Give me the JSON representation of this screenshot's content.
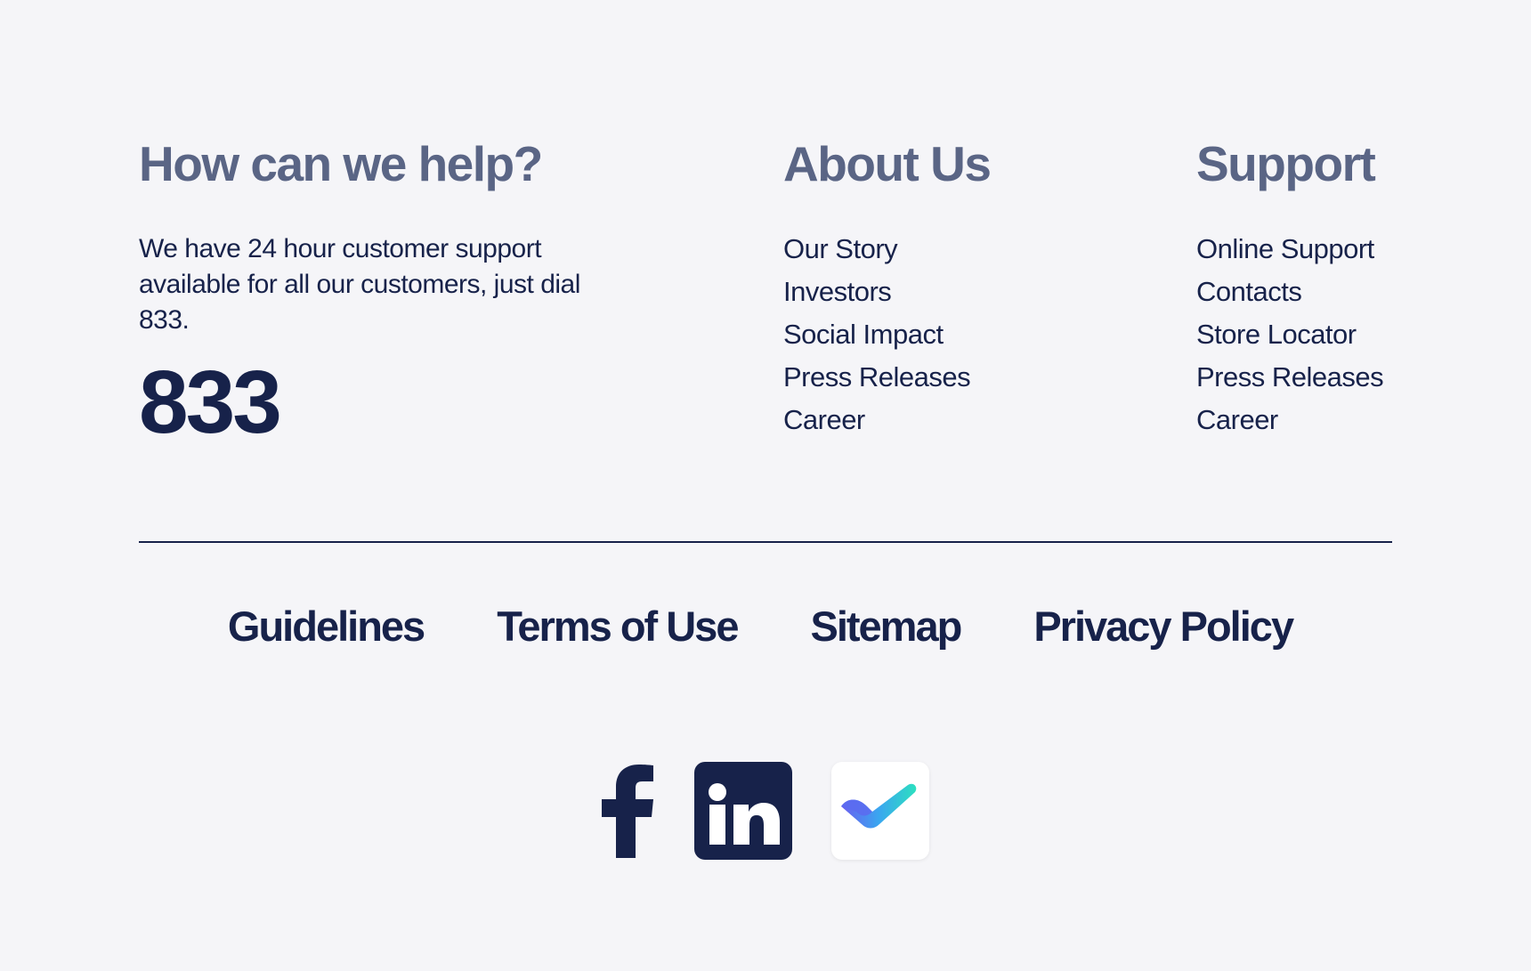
{
  "help": {
    "heading": "How can we help?",
    "text": "We have 24 hour customer support available for all our customers, just dial 833.",
    "phone": "833"
  },
  "about": {
    "heading": "About Us",
    "links": [
      "Our Story",
      "Investors",
      "Social Impact",
      "Press Releases",
      "Career"
    ]
  },
  "support": {
    "heading": "Support",
    "links": [
      "Online Support",
      "Contacts",
      "Store Locator",
      "Press Releases",
      "Career"
    ]
  },
  "bottom_links": [
    "Guidelines",
    "Terms of Use",
    "Sitemap",
    "Privacy Policy"
  ],
  "social": [
    {
      "icon": "facebook-icon"
    },
    {
      "icon": "linkedin-icon"
    },
    {
      "icon": "checkmark-app-icon"
    }
  ],
  "colors": {
    "background": "#f5f5f8",
    "heading": "#5a6585",
    "navy": "#17224a",
    "check_gradient_start": "#6a5df0",
    "check_gradient_end": "#2de0c0"
  }
}
